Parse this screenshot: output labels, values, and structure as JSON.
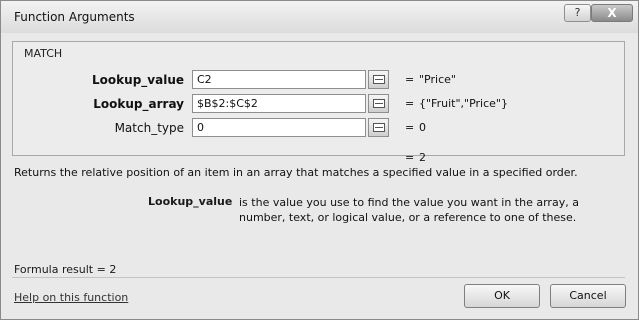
{
  "window": {
    "title": "Function Arguments",
    "help_label": "?",
    "close_label": "X"
  },
  "function": {
    "name": "MATCH",
    "arguments": [
      {
        "label": "Lookup_value",
        "bold": true,
        "value": "C2",
        "result": "\"Price\""
      },
      {
        "label": "Lookup_array",
        "bold": true,
        "value": "$B$2:$C$2",
        "result": "{\"Fruit\",\"Price\"}"
      },
      {
        "label": "Match_type",
        "bold": false,
        "value": "0",
        "result": "0"
      }
    ],
    "equals": "=",
    "formula_value": "2",
    "description": "Returns the relative position of an item in an array that matches a specified value in a specified order.",
    "arg_help": {
      "label": "Lookup_value",
      "text": "is the value you use to find the value you want in the array, a number, text, or logical value, or a reference to one of these."
    }
  },
  "footer": {
    "formula_result_label": "Formula result =",
    "formula_result_value": "2",
    "help_link": "Help on this function",
    "ok_label": "OK",
    "cancel_label": "Cancel"
  }
}
